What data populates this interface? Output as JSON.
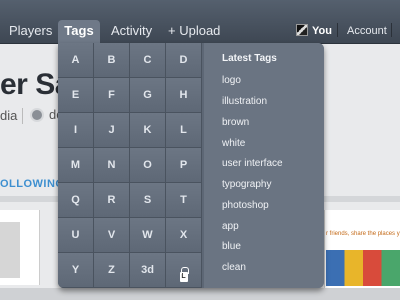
{
  "nav": {
    "players": "Players",
    "tags": "Tags",
    "activity": "Activity",
    "upload": "+ Upload",
    "user": "You",
    "account": "Account"
  },
  "background": {
    "title": "er Sanc",
    "subtitle_left": "dia",
    "subtitle_right": "de",
    "following": "OLLOWING",
    "right_card_text": "r friends, share the places you g... traordinary in the world around you"
  },
  "dropdown": {
    "letters": [
      "A",
      "B",
      "C",
      "D",
      "E",
      "F",
      "G",
      "H",
      "I",
      "J",
      "K",
      "L",
      "M",
      "N",
      "O",
      "P",
      "Q",
      "R",
      "S",
      "T",
      "U",
      "V",
      "W",
      "X",
      "Y",
      "Z",
      "3d",
      "lock"
    ],
    "lock_char": "L",
    "latest_title": "Latest Tags",
    "latest_tags": [
      "logo",
      "illustration",
      "brown",
      "white",
      "user interface",
      "typography",
      "photoshop",
      "app",
      "blue",
      "clean"
    ]
  }
}
